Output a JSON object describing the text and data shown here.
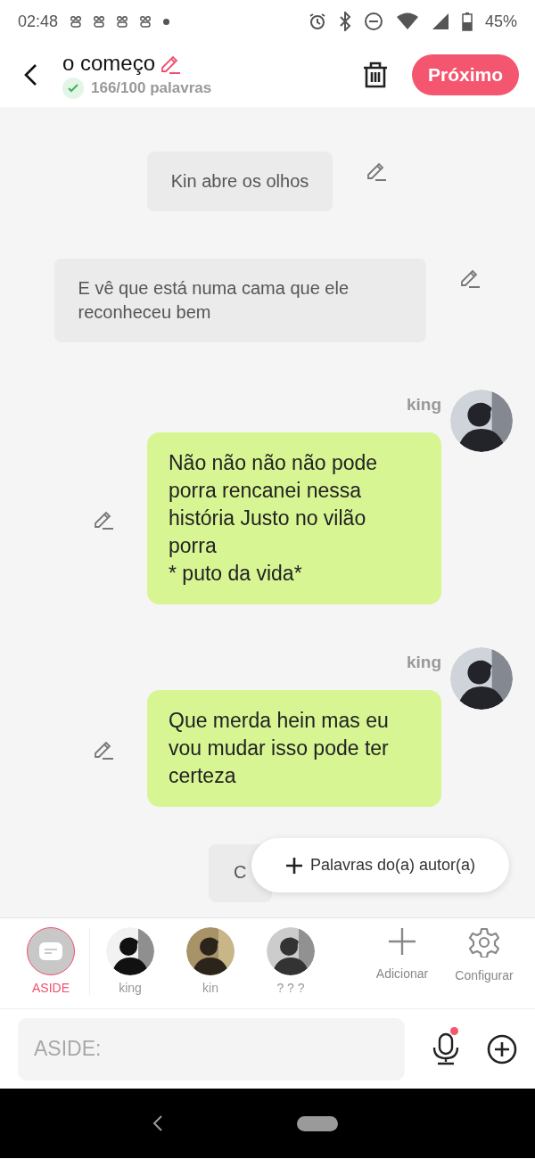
{
  "status_bar": {
    "time": "02:48",
    "battery": "45%"
  },
  "header": {
    "title": "o começo",
    "word_count": "166/100 palavras",
    "goal_met": true,
    "next_button": "Próximo"
  },
  "messages": [
    {
      "kind": "narration",
      "text": "Kin abre os olhos"
    },
    {
      "kind": "narration",
      "text": "E vê que está numa cama que ele reconheceu bem"
    },
    {
      "kind": "character",
      "name": "king",
      "text": "Não não não não pode porra rencanei nessa história Justo no vilão porra\n* puto da vida*"
    },
    {
      "kind": "character",
      "name": "king",
      "text": "Que merda hein mas eu vou mudar isso pode ter certeza"
    },
    {
      "kind": "covered",
      "text": "C"
    }
  ],
  "popup": {
    "label": "Palavras do(a) autor(a)"
  },
  "characters": [
    {
      "kind": "aside",
      "name": "ASIDE",
      "selected": true
    },
    {
      "kind": "avatar",
      "name": "king",
      "selected": false
    },
    {
      "kind": "avatar",
      "name": "kin",
      "selected": false
    },
    {
      "kind": "avatar",
      "name": "? ? ?",
      "selected": false
    }
  ],
  "actions": [
    {
      "kind": "add",
      "label": "Adicionar"
    },
    {
      "kind": "settings",
      "label": "Configurar"
    }
  ],
  "input": {
    "placeholder": "ASIDE:",
    "mic_badge": true
  }
}
